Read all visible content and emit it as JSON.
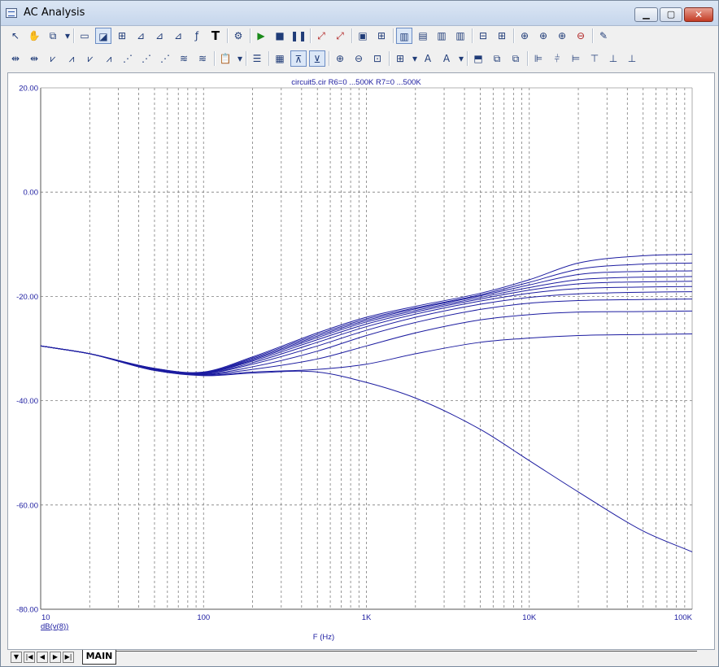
{
  "window": {
    "title": "AC Analysis"
  },
  "toolbar1_icons": [
    "select-arrow-icon",
    "pan-hand-icon",
    "component-icon",
    "dropdown-arrow-icon",
    "window-icon",
    "graph-icon",
    "graph-scale-icon",
    "graph-edit-icon",
    "graph-edit2-icon",
    "graph-edit3-icon",
    "function-icon",
    "text-tool-icon",
    "properties-icon",
    "run-icon",
    "stop-icon",
    "pause-icon",
    "probe-icon",
    "probe2-icon",
    "frame-icon",
    "grid-icon",
    "layout-a-icon",
    "layout-b-icon",
    "layout-c-icon",
    "layout-d-icon",
    "split-h-icon",
    "split-v-icon",
    "zoom-icon",
    "zoom2-icon",
    "zoom3-icon",
    "stop-sign-icon",
    "edit-icon"
  ],
  "toolbar2_icons": [
    "waveform-1-icon",
    "waveform-2-icon",
    "waveform-3-icon",
    "waveform-4-icon",
    "waveform-5-icon",
    "waveform-6-icon",
    "waveform-7-icon",
    "waveform-8-icon",
    "waveform-9-icon",
    "waveform-10-icon",
    "waveform-11-icon",
    "paste-icon",
    "dropdown-arrow-icon",
    "list-icon",
    "date-icon",
    "fit-icon",
    "fit2-icon",
    "zoom-in-icon",
    "zoom-out-icon",
    "zoom-fit-icon",
    "table-icon",
    "dropdown-arrow-icon",
    "font-icon",
    "font-color-icon",
    "dropdown-arrow-icon",
    "tag-icon",
    "copy-icon",
    "copy2-icon",
    "align-left-icon",
    "align-center-icon",
    "align-right-icon",
    "align-top-icon",
    "align-middle-icon",
    "align-bottom-icon"
  ],
  "bottom": {
    "sheet_tab": "MAIN"
  },
  "chart_data": {
    "type": "line",
    "title": "circuit5.cir R6=0 ...500K R7=0 ...500K",
    "xlabel": "F (Hz)",
    "ylabel": "dB(v(8))",
    "x_scale": "log",
    "xlim": [
      10,
      100000
    ],
    "ylim": [
      -80,
      20
    ],
    "x_tick_labels": [
      "10",
      "100",
      "1K",
      "10K",
      "100K"
    ],
    "y_tick_labels": [
      "20.00",
      "0.00",
      "-20.00",
      "-40.00",
      "-60.00",
      "-80.00"
    ],
    "grid": true,
    "line_color": "#1c1ca0",
    "x": [
      10,
      20,
      50,
      100,
      200,
      500,
      1000,
      2000,
      5000,
      10000,
      20000,
      50000,
      100000
    ],
    "series": [
      {
        "values": [
          -29.5,
          -31.0,
          -34.2,
          -35.2,
          -34.7,
          -34.5,
          -36.5,
          -39.5,
          -45.5,
          -51.5,
          -57.5,
          -65.0,
          -69.0
        ]
      },
      {
        "values": [
          -29.5,
          -31.0,
          -34.2,
          -35.1,
          -34.5,
          -34.0,
          -33.0,
          -31.0,
          -28.8,
          -28.0,
          -27.5,
          -27.3,
          -27.2
        ]
      },
      {
        "values": [
          -29.5,
          -31.0,
          -34.1,
          -35.0,
          -34.0,
          -32.0,
          -29.5,
          -27.0,
          -24.5,
          -23.5,
          -23.0,
          -22.9,
          -22.8
        ]
      },
      {
        "values": [
          -29.5,
          -31.0,
          -34.0,
          -34.9,
          -33.5,
          -30.5,
          -27.5,
          -25.0,
          -22.5,
          -21.3,
          -20.8,
          -20.6,
          -20.5
        ]
      },
      {
        "values": [
          -29.5,
          -31.0,
          -34.0,
          -34.8,
          -33.0,
          -29.5,
          -26.5,
          -24.0,
          -21.5,
          -20.2,
          -19.5,
          -19.2,
          -19.1
        ]
      },
      {
        "values": [
          -29.5,
          -31.0,
          -34.0,
          -34.8,
          -32.7,
          -28.8,
          -25.8,
          -23.4,
          -20.9,
          -19.4,
          -18.5,
          -18.2,
          -18.1
        ]
      },
      {
        "values": [
          -29.5,
          -31.0,
          -33.9,
          -34.7,
          -32.4,
          -28.3,
          -25.3,
          -23.0,
          -20.5,
          -18.8,
          -17.6,
          -17.2,
          -17.1
        ]
      },
      {
        "values": [
          -29.5,
          -31.0,
          -33.9,
          -34.7,
          -32.2,
          -27.9,
          -24.9,
          -22.7,
          -20.2,
          -18.3,
          -16.8,
          -16.3,
          -16.2
        ]
      },
      {
        "values": [
          -29.5,
          -31.0,
          -33.9,
          -34.6,
          -32.0,
          -27.6,
          -24.6,
          -22.4,
          -19.9,
          -17.8,
          -15.8,
          -15.2,
          -15.1
        ]
      },
      {
        "values": [
          -29.5,
          -31.0,
          -33.8,
          -34.6,
          -31.8,
          -27.3,
          -24.3,
          -22.2,
          -19.7,
          -17.3,
          -14.8,
          -13.8,
          -13.6
        ]
      },
      {
        "values": [
          -29.5,
          -31.0,
          -33.8,
          -34.5,
          -31.6,
          -27.0,
          -24.0,
          -21.9,
          -19.4,
          -16.8,
          -13.6,
          -12.2,
          -11.9
        ]
      }
    ]
  }
}
